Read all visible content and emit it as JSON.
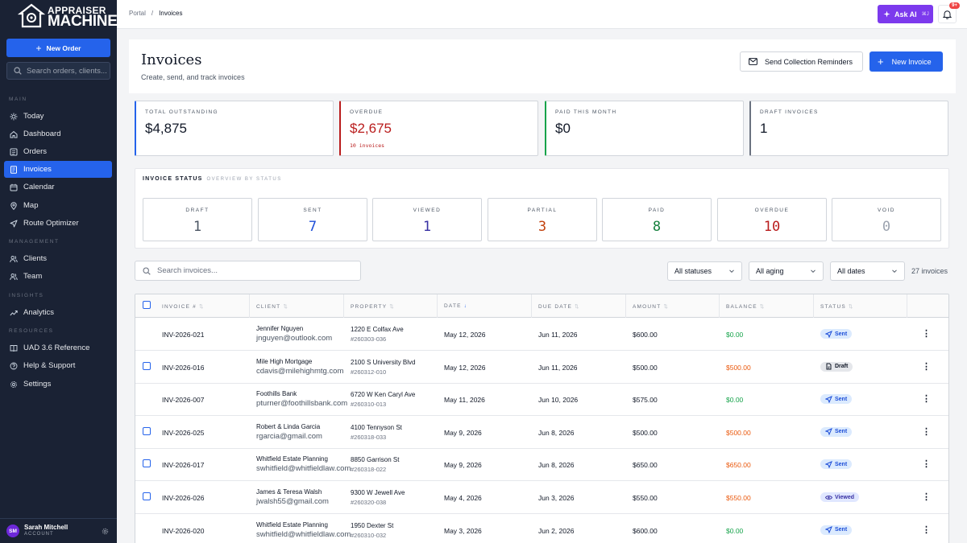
{
  "brand": {
    "line1": "APPRAISER",
    "line2": "MACHINE"
  },
  "sidebar": {
    "new_order": "New Order",
    "search_placeholder": "Search orders, clients...",
    "sections": {
      "main": "MAIN",
      "management": "MANAGEMENT",
      "insights": "INSIGHTS",
      "resources": "RESOURCES"
    },
    "items": {
      "today": "Today",
      "dashboard": "Dashboard",
      "orders": "Orders",
      "invoices": "Invoices",
      "calendar": "Calendar",
      "map": "Map",
      "route": "Route Optimizer",
      "clients": "Clients",
      "team": "Team",
      "analytics": "Analytics",
      "uad": "UAD 3.6 Reference",
      "help": "Help & Support",
      "settings": "Settings"
    },
    "active": "invoices",
    "user": {
      "initials": "SM",
      "name": "Sarah Mitchell",
      "role": "ACCOUNT"
    }
  },
  "topbar": {
    "breadcrumb": [
      "Portal",
      "Invoices"
    ],
    "ask_ai": "Ask AI",
    "ask_ai_shortcut": "⌘J",
    "notifications": "9+"
  },
  "header": {
    "title": "Invoices",
    "subtitle": "Create, send, and track invoices",
    "reminders_button": "Send Collection Reminders",
    "new_button": "New Invoice"
  },
  "stats": [
    {
      "label": "TOTAL OUTSTANDING",
      "value": "$4,875",
      "color": "#2563eb"
    },
    {
      "label": "OVERDUE",
      "value": "$2,675",
      "sub": "10 invoices",
      "color": "#b91c1c"
    },
    {
      "label": "PAID THIS MONTH",
      "value": "$0",
      "color": "#16a34a"
    },
    {
      "label": "DRAFT INVOICES",
      "value": "1",
      "color": "#6b7280"
    }
  ],
  "status_panel": {
    "title": "INVOICE STATUS",
    "subtitle": "OVERVIEW BY STATUS",
    "items": [
      {
        "label": "DRAFT",
        "value": "1",
        "color": "#4b5563"
      },
      {
        "label": "SENT",
        "value": "7",
        "color": "#1d4ed8"
      },
      {
        "label": "VIEWED",
        "value": "1",
        "color": "#3730a3"
      },
      {
        "label": "PARTIAL",
        "value": "3",
        "color": "#c2410c"
      },
      {
        "label": "PAID",
        "value": "8",
        "color": "#15803d"
      },
      {
        "label": "OVERDUE",
        "value": "10",
        "color": "#b91c1c"
      },
      {
        "label": "VOID",
        "value": "0",
        "color": "#9ca3af"
      }
    ]
  },
  "filters": {
    "search_placeholder": "Search invoices...",
    "status": "All statuses",
    "aging": "All aging",
    "dates": "All dates",
    "count": "27 invoices"
  },
  "table": {
    "columns": [
      "INVOICE #",
      "CLIENT",
      "PROPERTY",
      "DATE",
      "DUE DATE",
      "AMOUNT",
      "BALANCE",
      "STATUS"
    ],
    "sorted_column": "DATE",
    "rows": [
      {
        "checkbox": false,
        "invoice": "INV-2026-021",
        "client": "Jennifer Nguyen",
        "email": "jnguyen@outlook.com",
        "address": "1220 E Colfax Ave",
        "pid": "#260303-036",
        "date": "May 12, 2026",
        "due": "Jun 11, 2026",
        "amount": "$600.00",
        "balance": "$0.00",
        "balance_color": "#16a34a",
        "status": "Sent"
      },
      {
        "checkbox": true,
        "invoice": "INV-2026-016",
        "client": "Mile High Mortgage",
        "email": "cdavis@milehighmtg.com",
        "address": "2100 S University Blvd",
        "pid": "#260312-010",
        "date": "May 12, 2026",
        "due": "Jun 11, 2026",
        "amount": "$500.00",
        "balance": "$500.00",
        "balance_color": "#ea580c",
        "status": "Draft"
      },
      {
        "checkbox": false,
        "invoice": "INV-2026-007",
        "client": "Foothills Bank",
        "email": "pturner@foothillsbank.com",
        "address": "6720 W Ken Caryl Ave",
        "pid": "#260310-013",
        "date": "May 11, 2026",
        "due": "Jun 10, 2026",
        "amount": "$575.00",
        "balance": "$0.00",
        "balance_color": "#16a34a",
        "status": "Sent"
      },
      {
        "checkbox": true,
        "invoice": "INV-2026-025",
        "client": "Robert & Linda Garcia",
        "email": "rgarcia@gmail.com",
        "address": "4100 Tennyson St",
        "pid": "#260318-033",
        "date": "May 9, 2026",
        "due": "Jun 8, 2026",
        "amount": "$500.00",
        "balance": "$500.00",
        "balance_color": "#ea580c",
        "status": "Sent"
      },
      {
        "checkbox": true,
        "invoice": "INV-2026-017",
        "client": "Whitfield Estate Planning",
        "email": "swhitfield@whitfieldlaw.com",
        "address": "8850 Garrison St",
        "pid": "#260318-022",
        "date": "May 9, 2026",
        "due": "Jun 8, 2026",
        "amount": "$650.00",
        "balance": "$650.00",
        "balance_color": "#ea580c",
        "status": "Sent"
      },
      {
        "checkbox": true,
        "invoice": "INV-2026-026",
        "client": "James & Teresa Walsh",
        "email": "jwalsh55@gmail.com",
        "address": "9300 W Jewell Ave",
        "pid": "#260320-038",
        "date": "May 4, 2026",
        "due": "Jun 3, 2026",
        "amount": "$550.00",
        "balance": "$550.00",
        "balance_color": "#ea580c",
        "status": "Viewed"
      },
      {
        "checkbox": false,
        "invoice": "INV-2026-020",
        "client": "Whitfield Estate Planning",
        "email": "swhitfield@whitfieldlaw.com",
        "address": "1950 Dexter St",
        "pid": "#260310-032",
        "date": "May 3, 2026",
        "due": "Jun 2, 2026",
        "amount": "$600.00",
        "balance": "$0.00",
        "balance_color": "#16a34a",
        "status": "Sent"
      }
    ]
  }
}
